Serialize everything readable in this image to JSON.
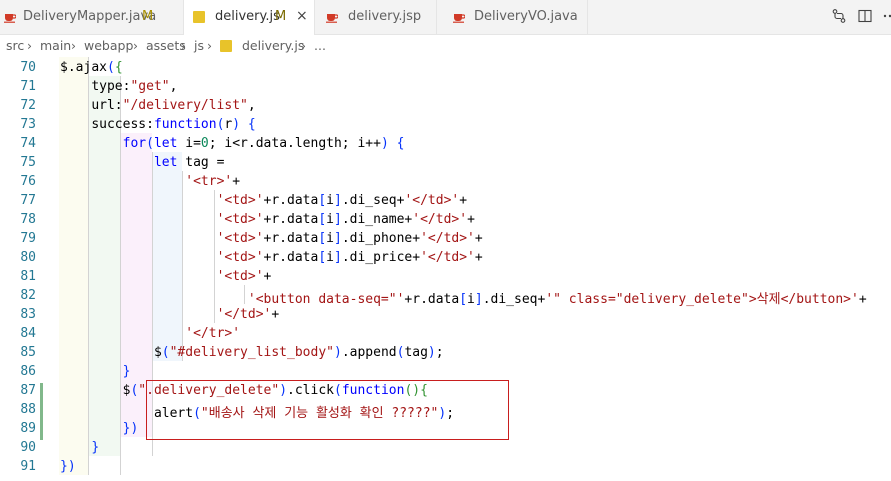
{
  "tabs": [
    {
      "label": "DeliveryMapper.java",
      "modified": "M",
      "icon": "java-icon",
      "active": false
    },
    {
      "label": "delivery.js",
      "modified": "M",
      "icon": "js-icon",
      "active": true,
      "close": "×"
    },
    {
      "label": "delivery.jsp",
      "modified": "",
      "icon": "java-icon",
      "active": false
    },
    {
      "label": "DeliveryVO.java",
      "modified": "",
      "icon": "java-icon",
      "active": false
    }
  ],
  "tab_actions": [
    "compare-changes-icon",
    "split-editor-icon",
    "more-actions-icon"
  ],
  "breadcrumb": {
    "parts": [
      "src",
      "main",
      "webapp",
      "assets",
      "js",
      "delivery.js",
      "..."
    ],
    "separator": "›"
  },
  "editor": {
    "lines": [
      {
        "number": "70",
        "text": "    $.ajax({"
      },
      {
        "number": "71",
        "text": "        type:\"get\","
      },
      {
        "number": "72",
        "text": "        url:\"/delivery/list\","
      },
      {
        "number": "73",
        "text": "        success:function(r) {"
      },
      {
        "number": "74",
        "text": "            for(let i=0; i<r.data.length; i++) {"
      },
      {
        "number": "75",
        "text": "                let tag ="
      },
      {
        "number": "76",
        "text": "                    '<tr>'+"
      },
      {
        "number": "77",
        "text": "                        '<td>'+r.data[i].di_seq+'</td>'+"
      },
      {
        "number": "78",
        "text": "                        '<td>'+r.data[i].di_name+'</td>'+"
      },
      {
        "number": "79",
        "text": "                        '<td>'+r.data[i].di_phone+'</td>'+"
      },
      {
        "number": "80",
        "text": "                        '<td>'+r.data[i].di_price+'</td>'+"
      },
      {
        "number": "81",
        "text": "                        '<td>'+"
      },
      {
        "number": "82",
        "text": "                            '<button data-seq=\"'+r.data[i].di_seq+'\" class=\"delivery_delete\">삭제</button>'+"
      },
      {
        "number": "83",
        "text": "                        '</td>'+"
      },
      {
        "number": "84",
        "text": "                    '</tr>'"
      },
      {
        "number": "85",
        "text": "                $(\"#delivery_list_body\").append(tag);"
      },
      {
        "number": "86",
        "text": "            }"
      },
      {
        "number": "87",
        "text": "            $(\".delivery_delete\").click(function(){"
      },
      {
        "number": "88",
        "text": "                alert(\"배송사 삭제 기능 활성화 확인 ?????\");"
      },
      {
        "number": "89",
        "text": "            })"
      },
      {
        "number": "90",
        "text": "        }"
      },
      {
        "number": "91",
        "text": "    })"
      }
    ]
  },
  "colors": {
    "keyword": "#0000ff",
    "string": "#a31515",
    "number": "#098658",
    "line_number": "#237893",
    "git_added": "#81b88b",
    "highlight_box": "#c81e1e",
    "modified_tab": "#c9a900"
  }
}
